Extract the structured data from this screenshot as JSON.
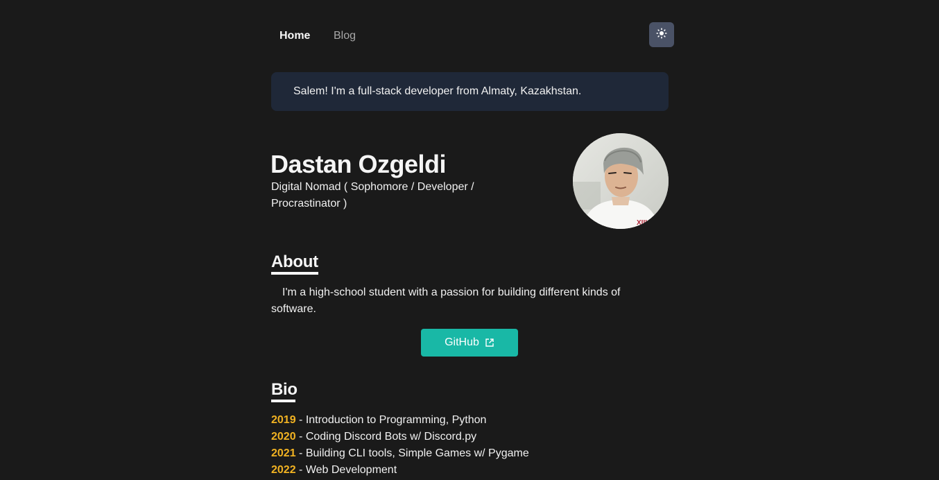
{
  "nav": {
    "home_label": "Home",
    "blog_label": "Blog",
    "theme_icon": "sun-icon"
  },
  "banner": {
    "text": "Salem! I'm a full-stack developer from Almaty, Kazakhstan."
  },
  "profile": {
    "name": "Dastan Ozgeldi",
    "tagline": "Digital Nomad ( Sophomore / Developer / Procrastinator )",
    "avatar_icon": "profile-photo"
  },
  "about": {
    "heading": "About",
    "text": "I'm a high-school student with a passion for building different kinds of software.",
    "github_label": "GitHub",
    "github_icon": "external-link-icon"
  },
  "bio": {
    "heading": "Bio",
    "items": [
      {
        "year": "2019",
        "text": " - Introduction to Programming, Python"
      },
      {
        "year": "2020",
        "text": " - Coding Discord Bots w/ Discord.py"
      },
      {
        "year": "2021",
        "text": " - Building CLI tools, Simple Games w/ Pygame"
      },
      {
        "year": "2022",
        "text": " - Web Development"
      }
    ]
  },
  "colors": {
    "background": "#1a1a1a",
    "banner": "#1f2838",
    "accent_teal": "#19b8a6",
    "year_yellow": "#f2b322",
    "toggle": "#4a5266"
  }
}
